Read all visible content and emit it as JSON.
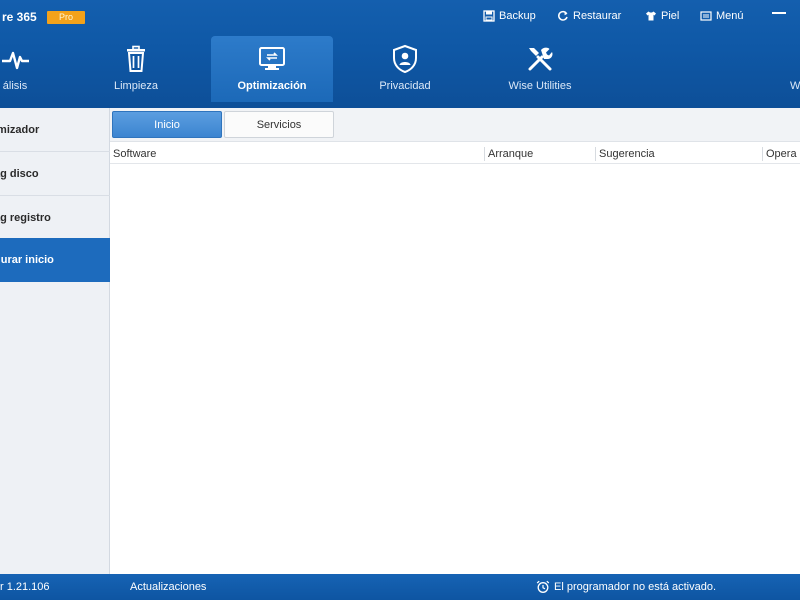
{
  "app": {
    "title": "re 365",
    "badge": "Pro"
  },
  "top_actions": {
    "backup": "Backup",
    "restore": "Restaurar",
    "skin": "Piel",
    "menu": "Menú"
  },
  "tabs": [
    {
      "label": "álisis",
      "icon": "pulse-icon"
    },
    {
      "label": "Limpieza",
      "icon": "trash-icon"
    },
    {
      "label": "Optimización",
      "icon": "monitor-icon",
      "active": true
    },
    {
      "label": "Privacidad",
      "icon": "shield-user-icon"
    },
    {
      "label": "Wise Utilities",
      "icon": "tools-icon"
    },
    {
      "label": "W",
      "icon": ""
    }
  ],
  "sidebar": {
    "items": [
      {
        "label": "imizador"
      },
      {
        "label": "ag disco"
      },
      {
        "label": "ag registro"
      },
      {
        "label": "gurar inicio",
        "active": true
      }
    ]
  },
  "subtabs": {
    "startup": "Inicio",
    "services": "Servicios"
  },
  "table": {
    "columns": [
      "Software",
      "Arranque",
      "Sugerencia",
      "Opera"
    ]
  },
  "status": {
    "version": "r 1.21.106",
    "updates": "Actualizaciones",
    "scheduler": "El programador no está activado."
  },
  "colors": {
    "header_blue": "#0f58a6",
    "active_tab": "#1c69b8",
    "sidebar_active": "#1d6bbd",
    "pro_badge": "#f3a21a"
  }
}
